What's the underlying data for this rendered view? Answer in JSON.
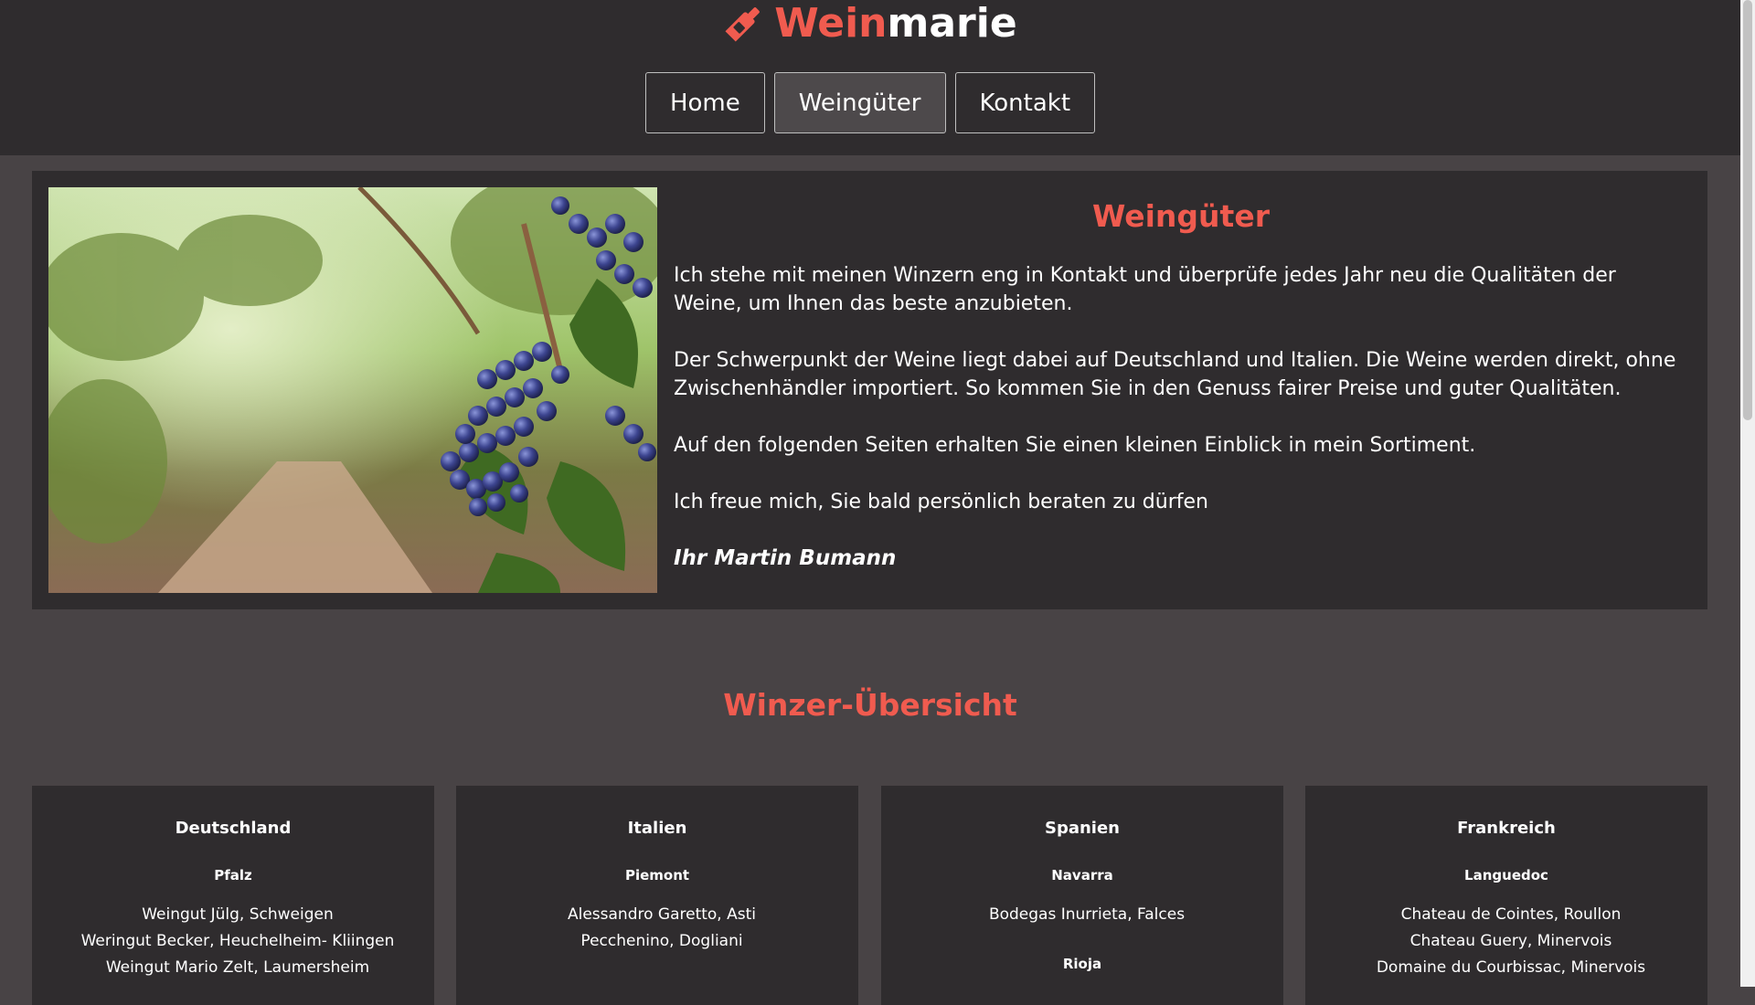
{
  "brand": {
    "part1": "Wein",
    "part2": "marie",
    "logo_icon": "wine-bottle-icon",
    "accent": "#f05b4f"
  },
  "nav": {
    "items": [
      {
        "label": "Home"
      },
      {
        "label": "Weingüter",
        "active": true
      },
      {
        "label": "Kontakt"
      }
    ]
  },
  "intro": {
    "title": "Weingüter",
    "paragraphs": [
      "Ich stehe mit meinen Winzern eng in Kontakt und überprüfe jedes Jahr neu die Qualitäten der Weine, um Ihnen das beste anzubieten.",
      "Der Schwerpunkt der Weine liegt dabei auf Deutschland und Italien. Die Weine werden direkt, ohne Zwischenhändler importiert. So kommen Sie in den Genuss fairer Preise und guter Qualitäten.",
      "Auf den folgenden Seiten erhalten Sie einen kleinen Einblick in mein Sortiment.",
      "Ich freue mich, Sie bald persönlich beraten zu dürfen"
    ],
    "signature": "Ihr Martin Bumann",
    "image_label": "vineyard-grapes-photo"
  },
  "overview": {
    "title": "Winzer-Übersicht",
    "cards": [
      {
        "country": "Deutschland",
        "region": "Pfalz",
        "wineries": [
          "Weingut Jülg, Schweigen",
          "Weringut Becker, Heuchelheim- Kliingen",
          "Weingut Mario Zelt, Laumersheim"
        ]
      },
      {
        "country": "Italien",
        "region": "Piemont",
        "wineries": [
          "Alessandro Garetto, Asti",
          "Pecchenino, Dogliani"
        ]
      },
      {
        "country": "Spanien",
        "region": "Navarra",
        "wineries": [
          "Bodegas Inurrieta, Falces"
        ],
        "region2": "Rioja"
      },
      {
        "country": "Frankreich",
        "region": "Languedoc",
        "wineries": [
          "Chateau de Cointes, Roullon",
          "Chateau Guery, Minervois",
          "Domaine du Courbissac, Minervois"
        ]
      }
    ]
  }
}
